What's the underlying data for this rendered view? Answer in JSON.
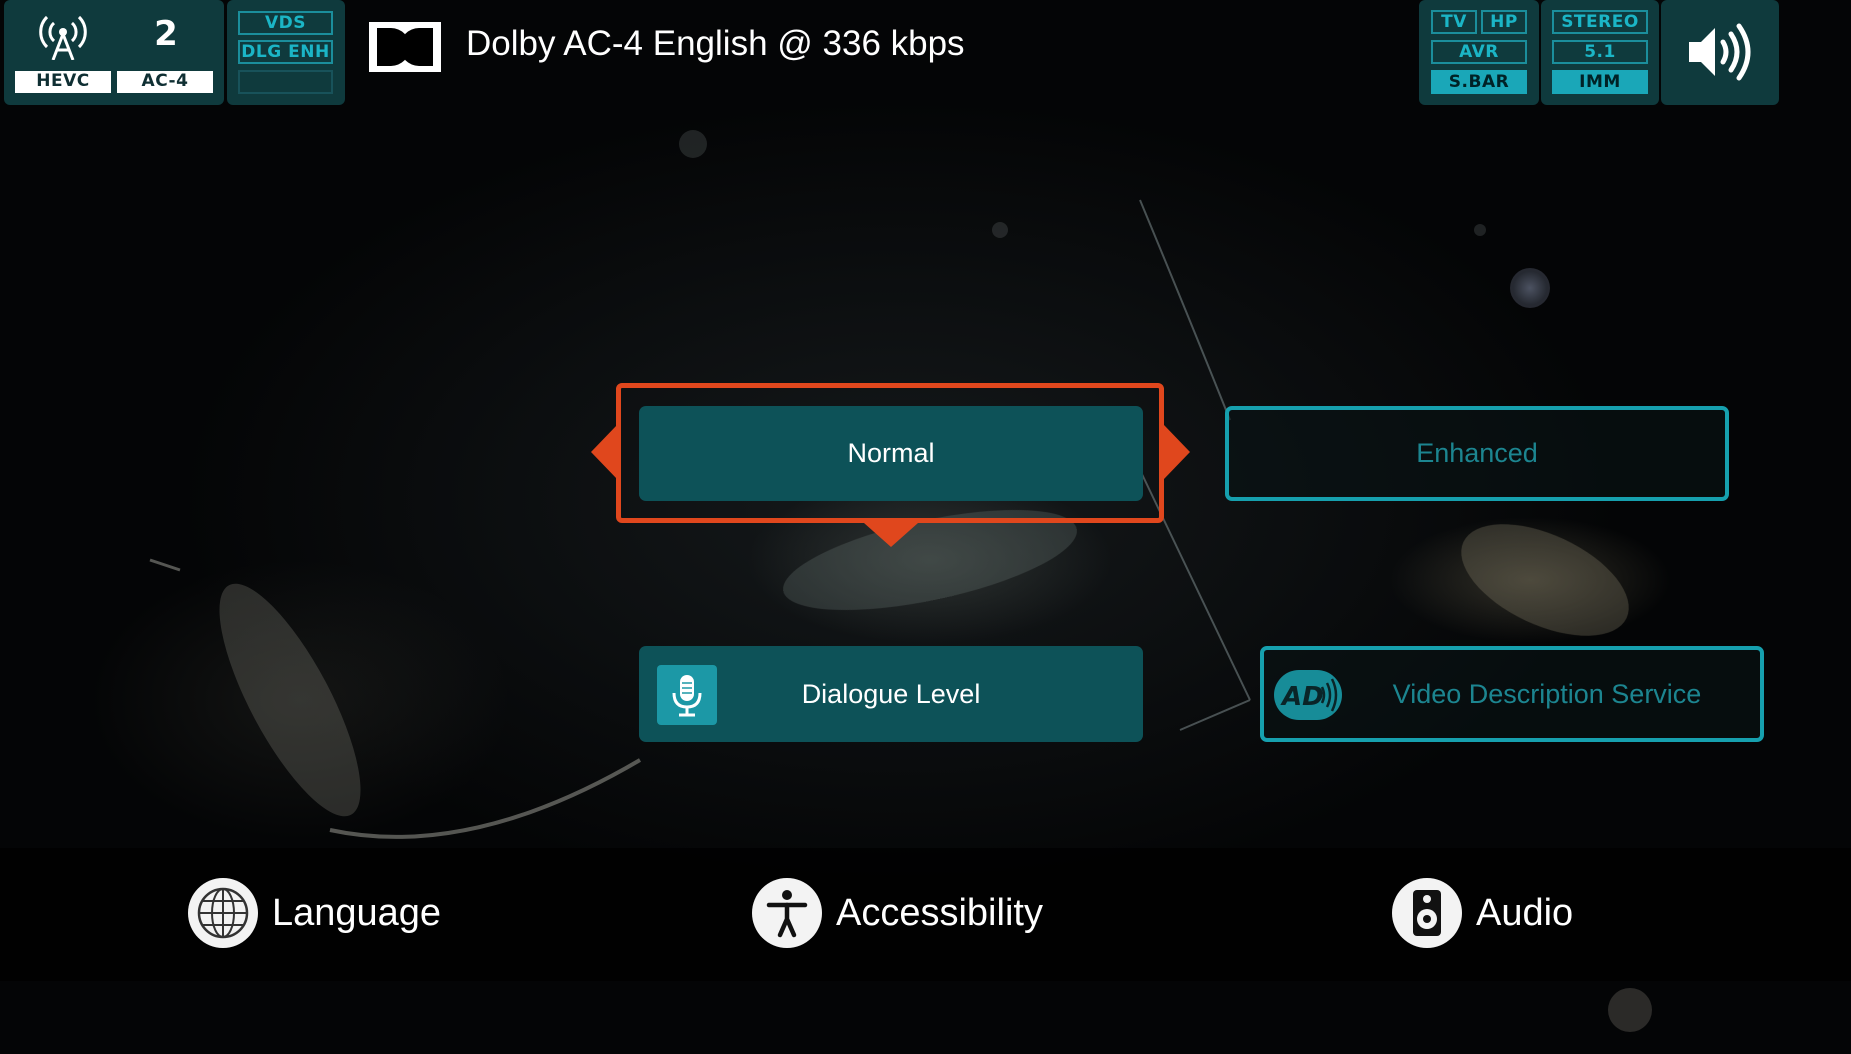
{
  "status_bar": {
    "channel_number": "2",
    "video_codec": "HEVC",
    "audio_codec": "AC-4",
    "feature_tags": [
      "VDS",
      "DLG ENH",
      ""
    ],
    "device_tags": {
      "tv": "TV",
      "hp": "HP",
      "avr": "AVR",
      "sbar": "S.BAR",
      "active": "S.BAR"
    },
    "channel_tags": {
      "stereo": "STEREO",
      "surround": "5.1",
      "imm": "IMM",
      "active": "IMM"
    },
    "icons": [
      "antenna-icon",
      "dolby-logo",
      "speaker-volume-icon"
    ]
  },
  "now_playing": {
    "text": "Dolby AC-4 English @ 336 kbps"
  },
  "options": {
    "dialogue_mode": {
      "normal": "Normal",
      "enhanced": "Enhanced",
      "selected": "Normal"
    },
    "dialogue_level": {
      "label": "Dialogue Level",
      "icon": "microphone-icon"
    },
    "video_description": {
      "label": "Video Description Service",
      "icon": "audio-description-icon",
      "badge_text": "AD"
    }
  },
  "bottom_nav": {
    "items": [
      {
        "label": "Language",
        "icon": "globe-icon"
      },
      {
        "label": "Accessibility",
        "icon": "accessibility-icon"
      },
      {
        "label": "Audio",
        "icon": "speaker-icon"
      }
    ]
  },
  "colors": {
    "focus": "#e0471d",
    "teal_dark": "#0d5258",
    "teal_accent": "#16a0ae",
    "panel": "#0f3a3d"
  }
}
